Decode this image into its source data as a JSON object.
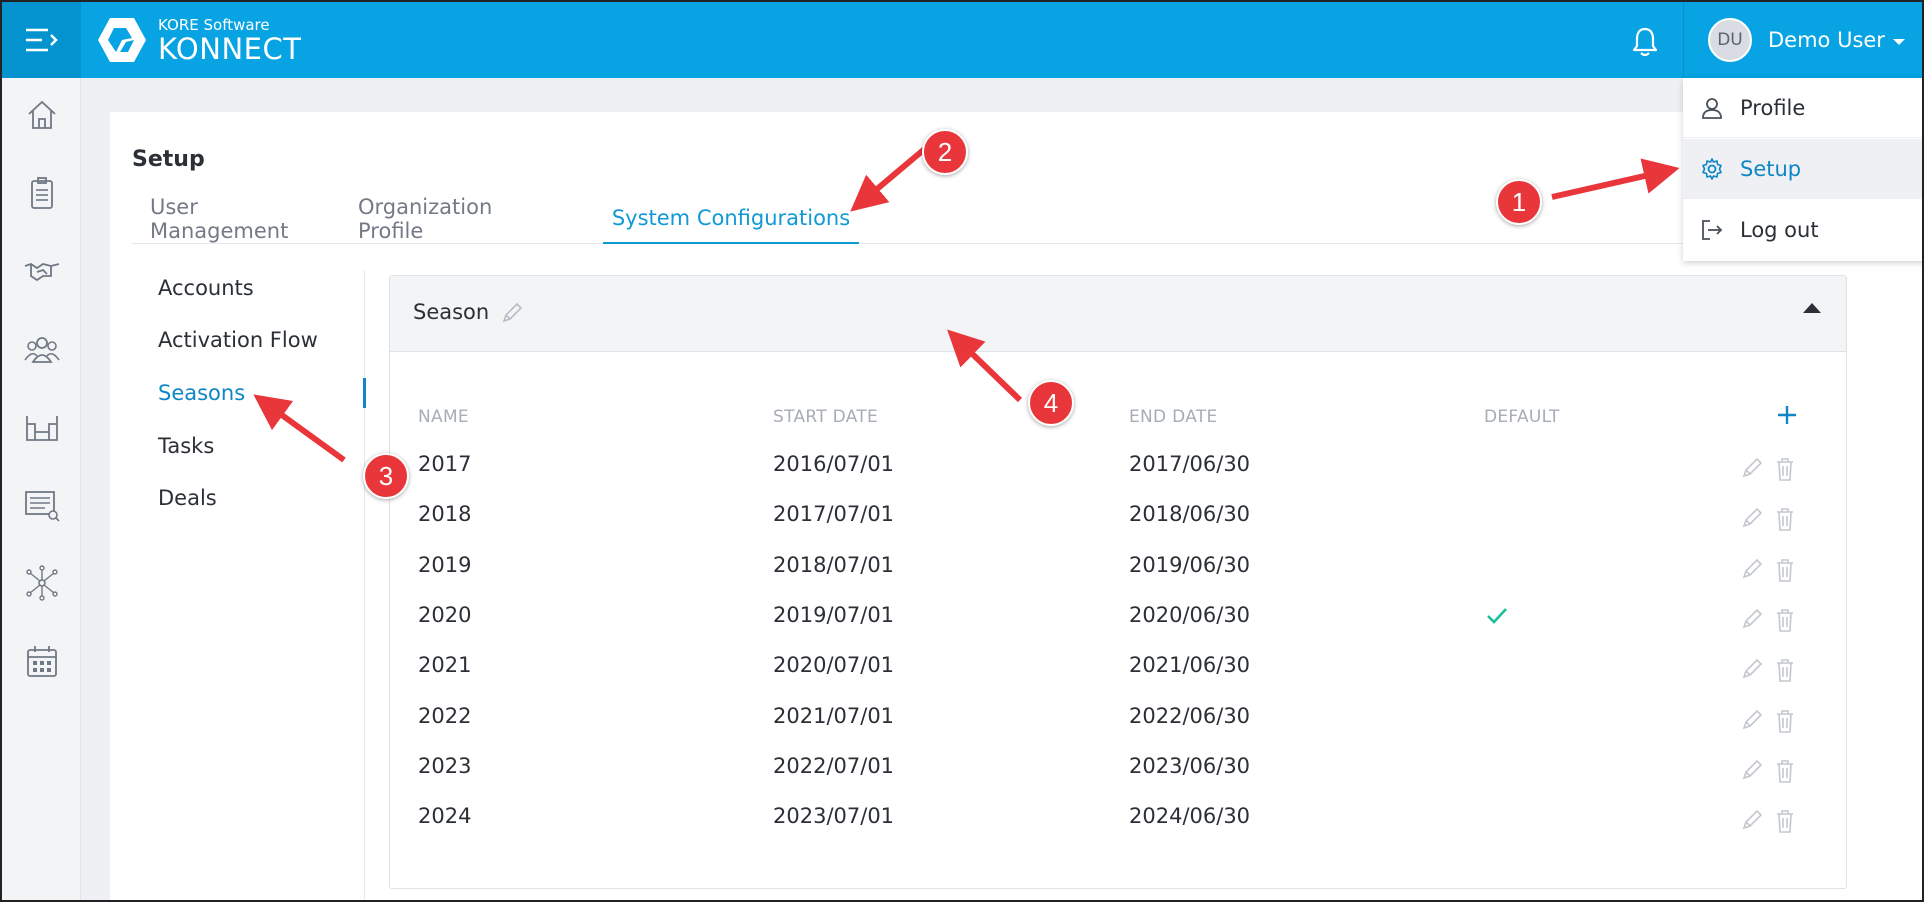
{
  "header": {
    "brand_small": "KORE Software",
    "brand_name": "KONNECT",
    "user_initials": "DU",
    "user_name": "Demo User"
  },
  "sidebar": {
    "icons": [
      "home-icon",
      "clipboard-icon",
      "handshake-icon",
      "people-icon",
      "stadium-icon",
      "list-search-icon",
      "network-icon",
      "calendar-icon"
    ]
  },
  "page": {
    "title": "Setup",
    "tabs": [
      "User Management",
      "Organization Profile",
      "System Configurations"
    ],
    "active_tab": "System Configurations"
  },
  "leftnav": {
    "items": [
      "Accounts",
      "Activation Flow",
      "Seasons",
      "Tasks",
      "Deals"
    ],
    "active": "Seasons"
  },
  "season_panel": {
    "title": "Season",
    "columns": [
      "NAME",
      "START DATE",
      "END DATE",
      "DEFAULT"
    ],
    "rows": [
      {
        "name": "2017",
        "start": "2016/07/01",
        "end": "2017/06/30",
        "default": false
      },
      {
        "name": "2018",
        "start": "2017/07/01",
        "end": "2018/06/30",
        "default": false
      },
      {
        "name": "2019",
        "start": "2018/07/01",
        "end": "2019/06/30",
        "default": false
      },
      {
        "name": "2020",
        "start": "2019/07/01",
        "end": "2020/06/30",
        "default": true
      },
      {
        "name": "2021",
        "start": "2020/07/01",
        "end": "2021/06/30",
        "default": false
      },
      {
        "name": "2022",
        "start": "2021/07/01",
        "end": "2022/06/30",
        "default": false
      },
      {
        "name": "2023",
        "start": "2022/07/01",
        "end": "2023/06/30",
        "default": false
      },
      {
        "name": "2024",
        "start": "2023/07/01",
        "end": "2024/06/30",
        "default": false
      }
    ]
  },
  "user_menu": {
    "items": [
      "Profile",
      "Setup",
      "Log out"
    ],
    "active": "Setup"
  },
  "annotations": {
    "steps": [
      "1",
      "2",
      "3",
      "4"
    ]
  },
  "colors": {
    "topbar": "#07a3e2",
    "accent": "#0f9ad6",
    "check": "#1bbf9a",
    "annotation": "#e8363a"
  }
}
